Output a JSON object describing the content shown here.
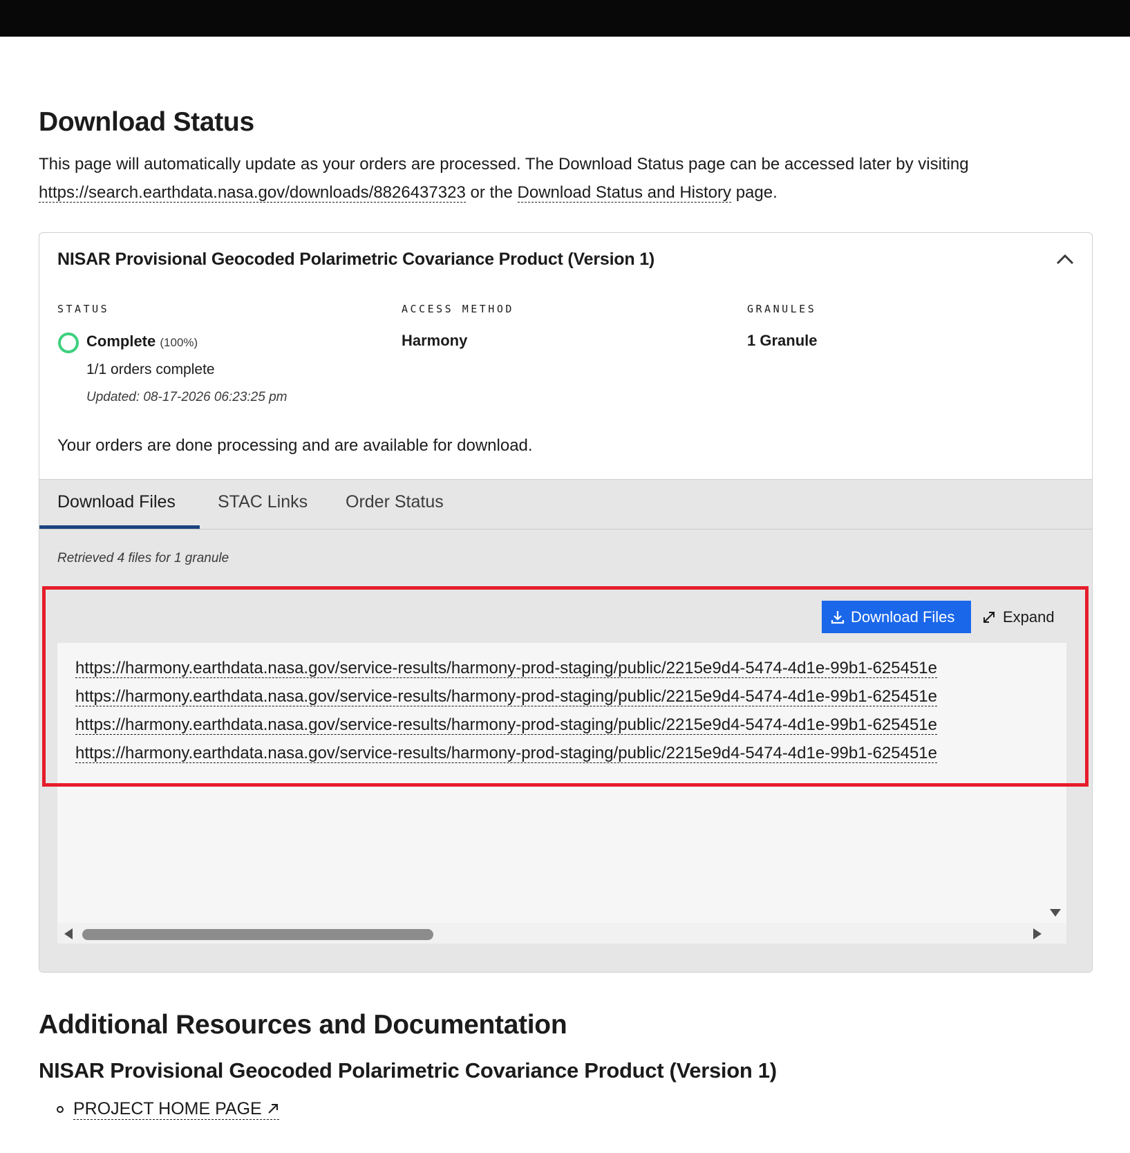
{
  "page": {
    "title": "Download Status",
    "intro_text_1": "This page will automatically update as your orders are processed. The Download Status page can be accessed later by visiting",
    "intro_link_url": "https://search.earthdata.nasa.gov/downloads/8826437323",
    "intro_text_2": "or the",
    "intro_link_history": "Download Status and History",
    "intro_text_3": "page."
  },
  "card": {
    "title": "NISAR Provisional Geocoded Polarimetric Covariance Product (Version 1)",
    "status_label": "STATUS",
    "status_value": "Complete",
    "status_percent": "(100%)",
    "orders_complete": "1/1 orders complete",
    "updated": "Updated: 08-17-2026 06:23:25 pm",
    "access_label": "ACCESS METHOD",
    "access_value": "Harmony",
    "granules_label": "GRANULES",
    "granules_value": "1 Granule",
    "done_message": "Your orders are done processing and are available for download."
  },
  "tabs": [
    {
      "label": "Download Files"
    },
    {
      "label": "STAC Links"
    },
    {
      "label": "Order Status"
    }
  ],
  "downloads": {
    "retrieved": "Retrieved 4 files for 1 granule",
    "download_button": "Download Files",
    "expand_button": "Expand",
    "urls": [
      "https://harmony.earthdata.nasa.gov/service-results/harmony-prod-staging/public/2215e9d4-5474-4d1e-99b1-625451e",
      "https://harmony.earthdata.nasa.gov/service-results/harmony-prod-staging/public/2215e9d4-5474-4d1e-99b1-625451e",
      "https://harmony.earthdata.nasa.gov/service-results/harmony-prod-staging/public/2215e9d4-5474-4d1e-99b1-625451e",
      "https://harmony.earthdata.nasa.gov/service-results/harmony-prod-staging/public/2215e9d4-5474-4d1e-99b1-625451e"
    ]
  },
  "resources": {
    "title": "Additional Resources and Documentation",
    "subtitle": "NISAR Provisional Geocoded Polarimetric Covariance Product (Version 1)",
    "links": [
      {
        "label": "PROJECT HOME PAGE"
      }
    ]
  },
  "colors": {
    "accent": "#1a67ea",
    "tab_underline": "#1a4480",
    "status_ring": "#3ed07f",
    "highlight": "#e61d2b"
  }
}
